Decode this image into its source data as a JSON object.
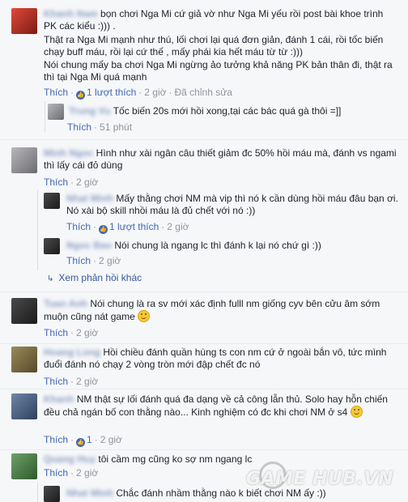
{
  "watermark": "GAME HUB.VN",
  "colors": {
    "link": "#4267b2",
    "name": "#365899",
    "meta": "#90949c",
    "background": "#f6f7f9"
  },
  "comments": [
    {
      "text": "bọn chơi Nga Mi cứ giả vờ như Nga Mi yếu rồi post bài khoe trình PK các kiểu :))) .",
      "text2": "Thật ra Nga Mi mạnh như thú, lối chơi lại quá đơn giản, đánh 1 cái, rồi tốc biến chạy buff máu, rồi lại cứ thế , mấy phái kia hết máu từ từ :)))",
      "text3": "Nói chung mấy ba chơi Nga Mi ngừng ảo tưởng khả năng PK bản thân đi, thật ra thì tại Nga Mi quá mạnh",
      "like": "Thích",
      "likes": "1 lượt thích",
      "time": "2 giờ",
      "edit": "Đã chỉnh sửa"
    },
    {
      "text": "Tốc biến 20s mới hồi xong,tại các bác quá gà thôi =]]",
      "like": "Thích",
      "time": "51 phút"
    },
    {
      "text": "Hình như xài ngân câu thiết giảm đc 50% hồi máu mà, đánh vs ngami thì lấy cái đỏ dùng",
      "like": "Thích",
      "time": "2 giờ"
    },
    {
      "text": "Mấy thằng chơi NM mà vip thì nó k cần dùng hồi máu đâu bạn ơi. Nó xài bộ skill nhồi máu là đủ chết với nó :))",
      "like": "Thích",
      "likes": "1 lượt thích",
      "time": "2 giờ"
    },
    {
      "text": "Nói chung là ngang lc thì đánh k lại nó chứ gì :))",
      "like": "Thích",
      "time": "2 giờ"
    },
    {
      "more": "Xem phản hồi khác"
    },
    {
      "text": "Nói chung là ra sv mới xác định fulll nm giống cyv bên cửu âm sớm muộn cũng nát game",
      "like": "Thích",
      "time": "2 giờ"
    },
    {
      "text": "Hồi chiều đánh quần hùng ts con nm cứ ở ngoài bắn vô, tức mình đuổi đánh nó chạy 2 vòng tròn mới đập chết đc nó",
      "like": "Thích",
      "time": "2 giờ"
    },
    {
      "text": "NM thật sự lối đánh quá đa dạng về cả công lẫn thủ. Solo hay hỗn chiến đều chả ngán bố con thằng nào... Kinh nghiệm có đc khi chơi NM ở s4",
      "like": "Thích",
      "likes": "1",
      "time": "2 giờ"
    },
    {
      "text": "tôi cầm mg cũng ko sợ nm ngang lc",
      "like": "Thích",
      "time": "2 giờ"
    },
    {
      "text": "Chắc đánh nhầm thằng nào k biết chơi NM ấy :))"
    }
  ]
}
